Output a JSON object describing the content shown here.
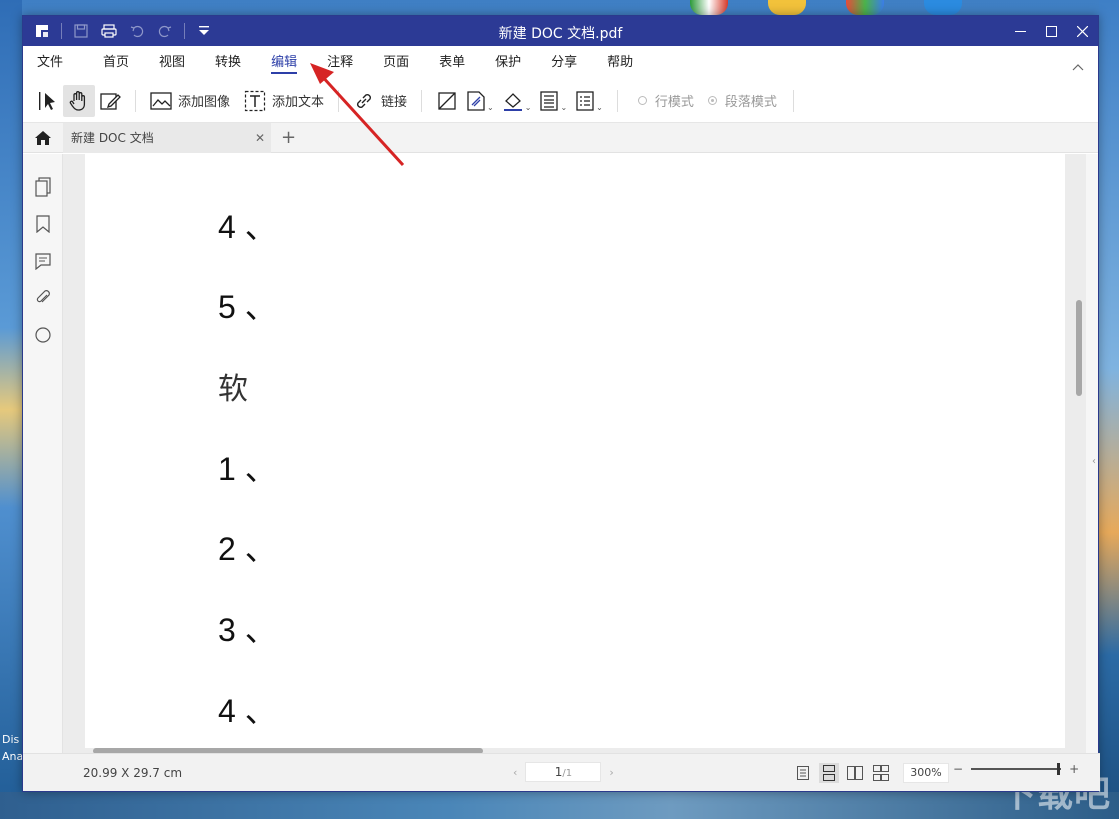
{
  "desktop": {
    "left_labels": [
      "Dis",
      "Ana"
    ],
    "watermark": "下载吧"
  },
  "window": {
    "title": "新建 DOC 文档.pdf"
  },
  "menu": {
    "items": [
      "文件",
      "首页",
      "视图",
      "转换",
      "编辑",
      "注释",
      "页面",
      "表单",
      "保护",
      "分享",
      "帮助"
    ],
    "active": "编辑"
  },
  "toolbar": {
    "add_image": "添加图像",
    "add_text": "添加文本",
    "link": "链接",
    "line_mode": "行模式",
    "paragraph_mode": "段落模式"
  },
  "tab": {
    "doc_title": "新建 DOC 文档"
  },
  "document": {
    "lines": [
      "4 、",
      "5 、",
      "软",
      "1 、",
      "2 、",
      "3 、",
      "4 、"
    ]
  },
  "status": {
    "page_size": "20.99 X 29.7 cm",
    "page_current": "1",
    "page_total": "/1",
    "zoom": "300%",
    "zoom_minus": "−",
    "zoom_plus": "+"
  },
  "colors": {
    "titlebar": "#2c3a95",
    "accent": "#2d3fa8",
    "annotation_arrow": "#d62424"
  }
}
